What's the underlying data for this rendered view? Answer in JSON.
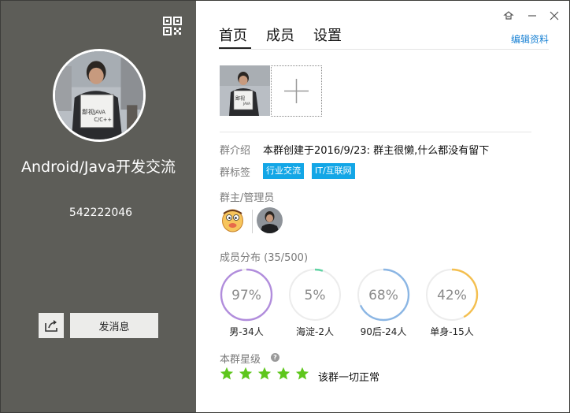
{
  "profile": {
    "name": "Android/Java开发交流",
    "group_id": "542222046",
    "sign_text": "鄙视 JAVA C/C++",
    "send_message_label": "发消息"
  },
  "tabs": [
    {
      "label": "首页",
      "active": true
    },
    {
      "label": "成员",
      "active": false
    },
    {
      "label": "设置",
      "active": false
    }
  ],
  "edit_label": "编辑资料",
  "intro": {
    "label": "群介绍",
    "text": "本群创建于2016/9/23: 群主很懒,什么都没有留下"
  },
  "tags": {
    "label": "群标签",
    "items": [
      "行业交流",
      "IT/互联网"
    ]
  },
  "admins": {
    "label": "群主/管理员"
  },
  "distribution": {
    "label": "成员分布 (35/500)",
    "items": [
      {
        "percent_text": "97%",
        "value": 97,
        "caption": "男-34人",
        "color": "#b18ddc"
      },
      {
        "percent_text": "5%",
        "value": 5,
        "caption": "海淀-2人",
        "color": "#5fd3a3"
      },
      {
        "percent_text": "68%",
        "value": 68,
        "caption": "90后-24人",
        "color": "#8bb6e4"
      },
      {
        "percent_text": "42%",
        "value": 42,
        "caption": "单身-15人",
        "color": "#f4bf4f"
      }
    ]
  },
  "rating": {
    "label": "本群星级",
    "stars": 5,
    "status": "该群一切正常",
    "star_color": "#5ec61c"
  },
  "colors": {
    "sidebar": "#5d5d58",
    "link": "#1a82d4",
    "tag": "#13a6e6"
  }
}
